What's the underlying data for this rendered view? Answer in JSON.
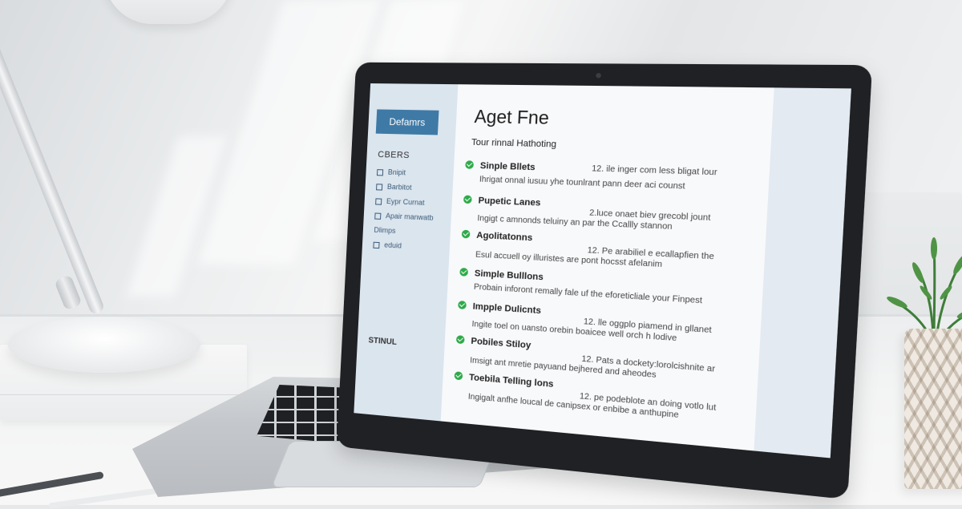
{
  "screen": {
    "sidebar": {
      "button_label": "Defamrs",
      "section_title": "CBERS",
      "items": [
        "Bnipit",
        "Barbitot",
        "Eypr Curnat",
        "Apair manwatb",
        "Dlimps",
        "eduid"
      ],
      "footer_label": "STINUL"
    },
    "main": {
      "title": "Aget Fne",
      "subtitle": "Tour rinnal Hathoting",
      "entries": [
        {
          "heading": "Sinple Bllets",
          "meta": "12. ile inger com less bligat lour",
          "desc": "Ihrigat onnal iusuu yhe tounlrant pann deer aci counst"
        },
        {
          "heading": "Pupetic Lanes",
          "meta": "2.luce onaet biev grecobl jount",
          "desc": "Ingigt c amnonds teluiny an par the Ccallly stannon"
        },
        {
          "heading": "Agolitatonns",
          "meta": "12. Pe arabiliel e ecallapfien the",
          "desc": "Esul accuell oy illuristes are pont hocsst afelanim"
        },
        {
          "heading": "Simple Bulllons",
          "meta": "",
          "desc": "Probain inforont remally fale uf the eforeticliale your Finpest"
        },
        {
          "heading": "Impple Dulicnts",
          "meta": "12. lle oggplo piamend in gllanet",
          "desc": "Ingite toel on uansto orebin boaicee well orch h lodive"
        },
        {
          "heading": "Pobiles Stiloy",
          "meta": "12. Pats a dockety:lorolcishnite ar",
          "desc": "Imsigt ant mretie payuand bejhered and aheodes"
        },
        {
          "heading": "Toebila Telling lons",
          "meta": "12. pe podeblote an doing votlo lut",
          "desc": "Ingigalt anfhe loucal de canipsex or enbibe a anthupine"
        }
      ]
    }
  },
  "colors": {
    "accent": "#3f7aa6",
    "check": "#2eaa4a",
    "laptop_bezel": "#1f2124"
  },
  "icons": {
    "check": "check-circle-icon",
    "sidebar_item": "square-icon"
  }
}
